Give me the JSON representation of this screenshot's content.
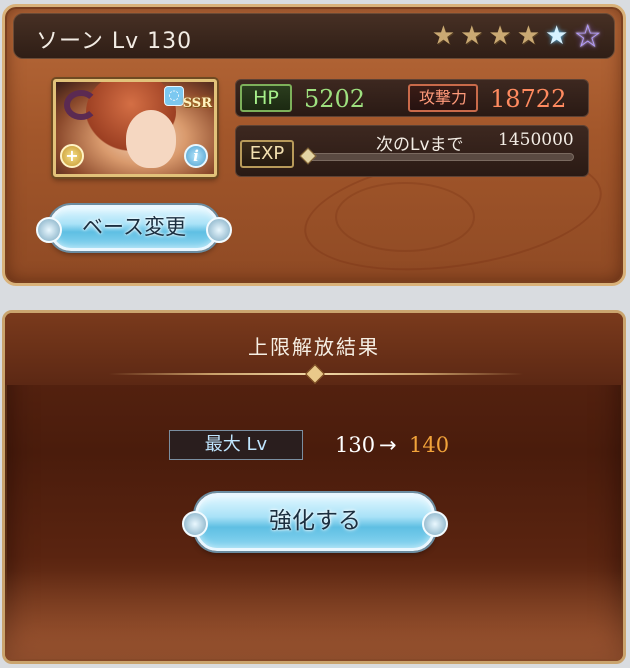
{
  "card": {
    "title": "ソーン Lv 130",
    "stars": [
      {
        "icon": "star-icon",
        "color": "#caa973"
      },
      {
        "icon": "star-icon",
        "color": "#caa973"
      },
      {
        "icon": "star-icon",
        "color": "#caa973"
      },
      {
        "icon": "star-icon",
        "color": "#caa973"
      },
      {
        "icon": "blue-star-icon",
        "color": "#d7f2ff"
      },
      {
        "icon": "purple-star-icon",
        "color": "#b59bff"
      }
    ],
    "rarity": "SSR",
    "stats": {
      "hp_label": "HP",
      "hp_value": "5202",
      "atk_label": "攻撃力",
      "atk_value": "18722"
    },
    "exp": {
      "label": "EXP",
      "next_text": "次のLvまで",
      "next_value": "1450000",
      "progress": 0
    },
    "base_change_label": "ベース変更"
  },
  "result": {
    "title": "上限解放結果",
    "maxlv_label": "最大 Lv",
    "lv_old": "130",
    "lv_arrow": "→",
    "lv_new": "140",
    "enhance_label": "強化する"
  },
  "colors": {
    "accent_new_level": "#f2a33a",
    "hp_green": "#9ee07f",
    "atk_red": "#ff8a5f"
  }
}
